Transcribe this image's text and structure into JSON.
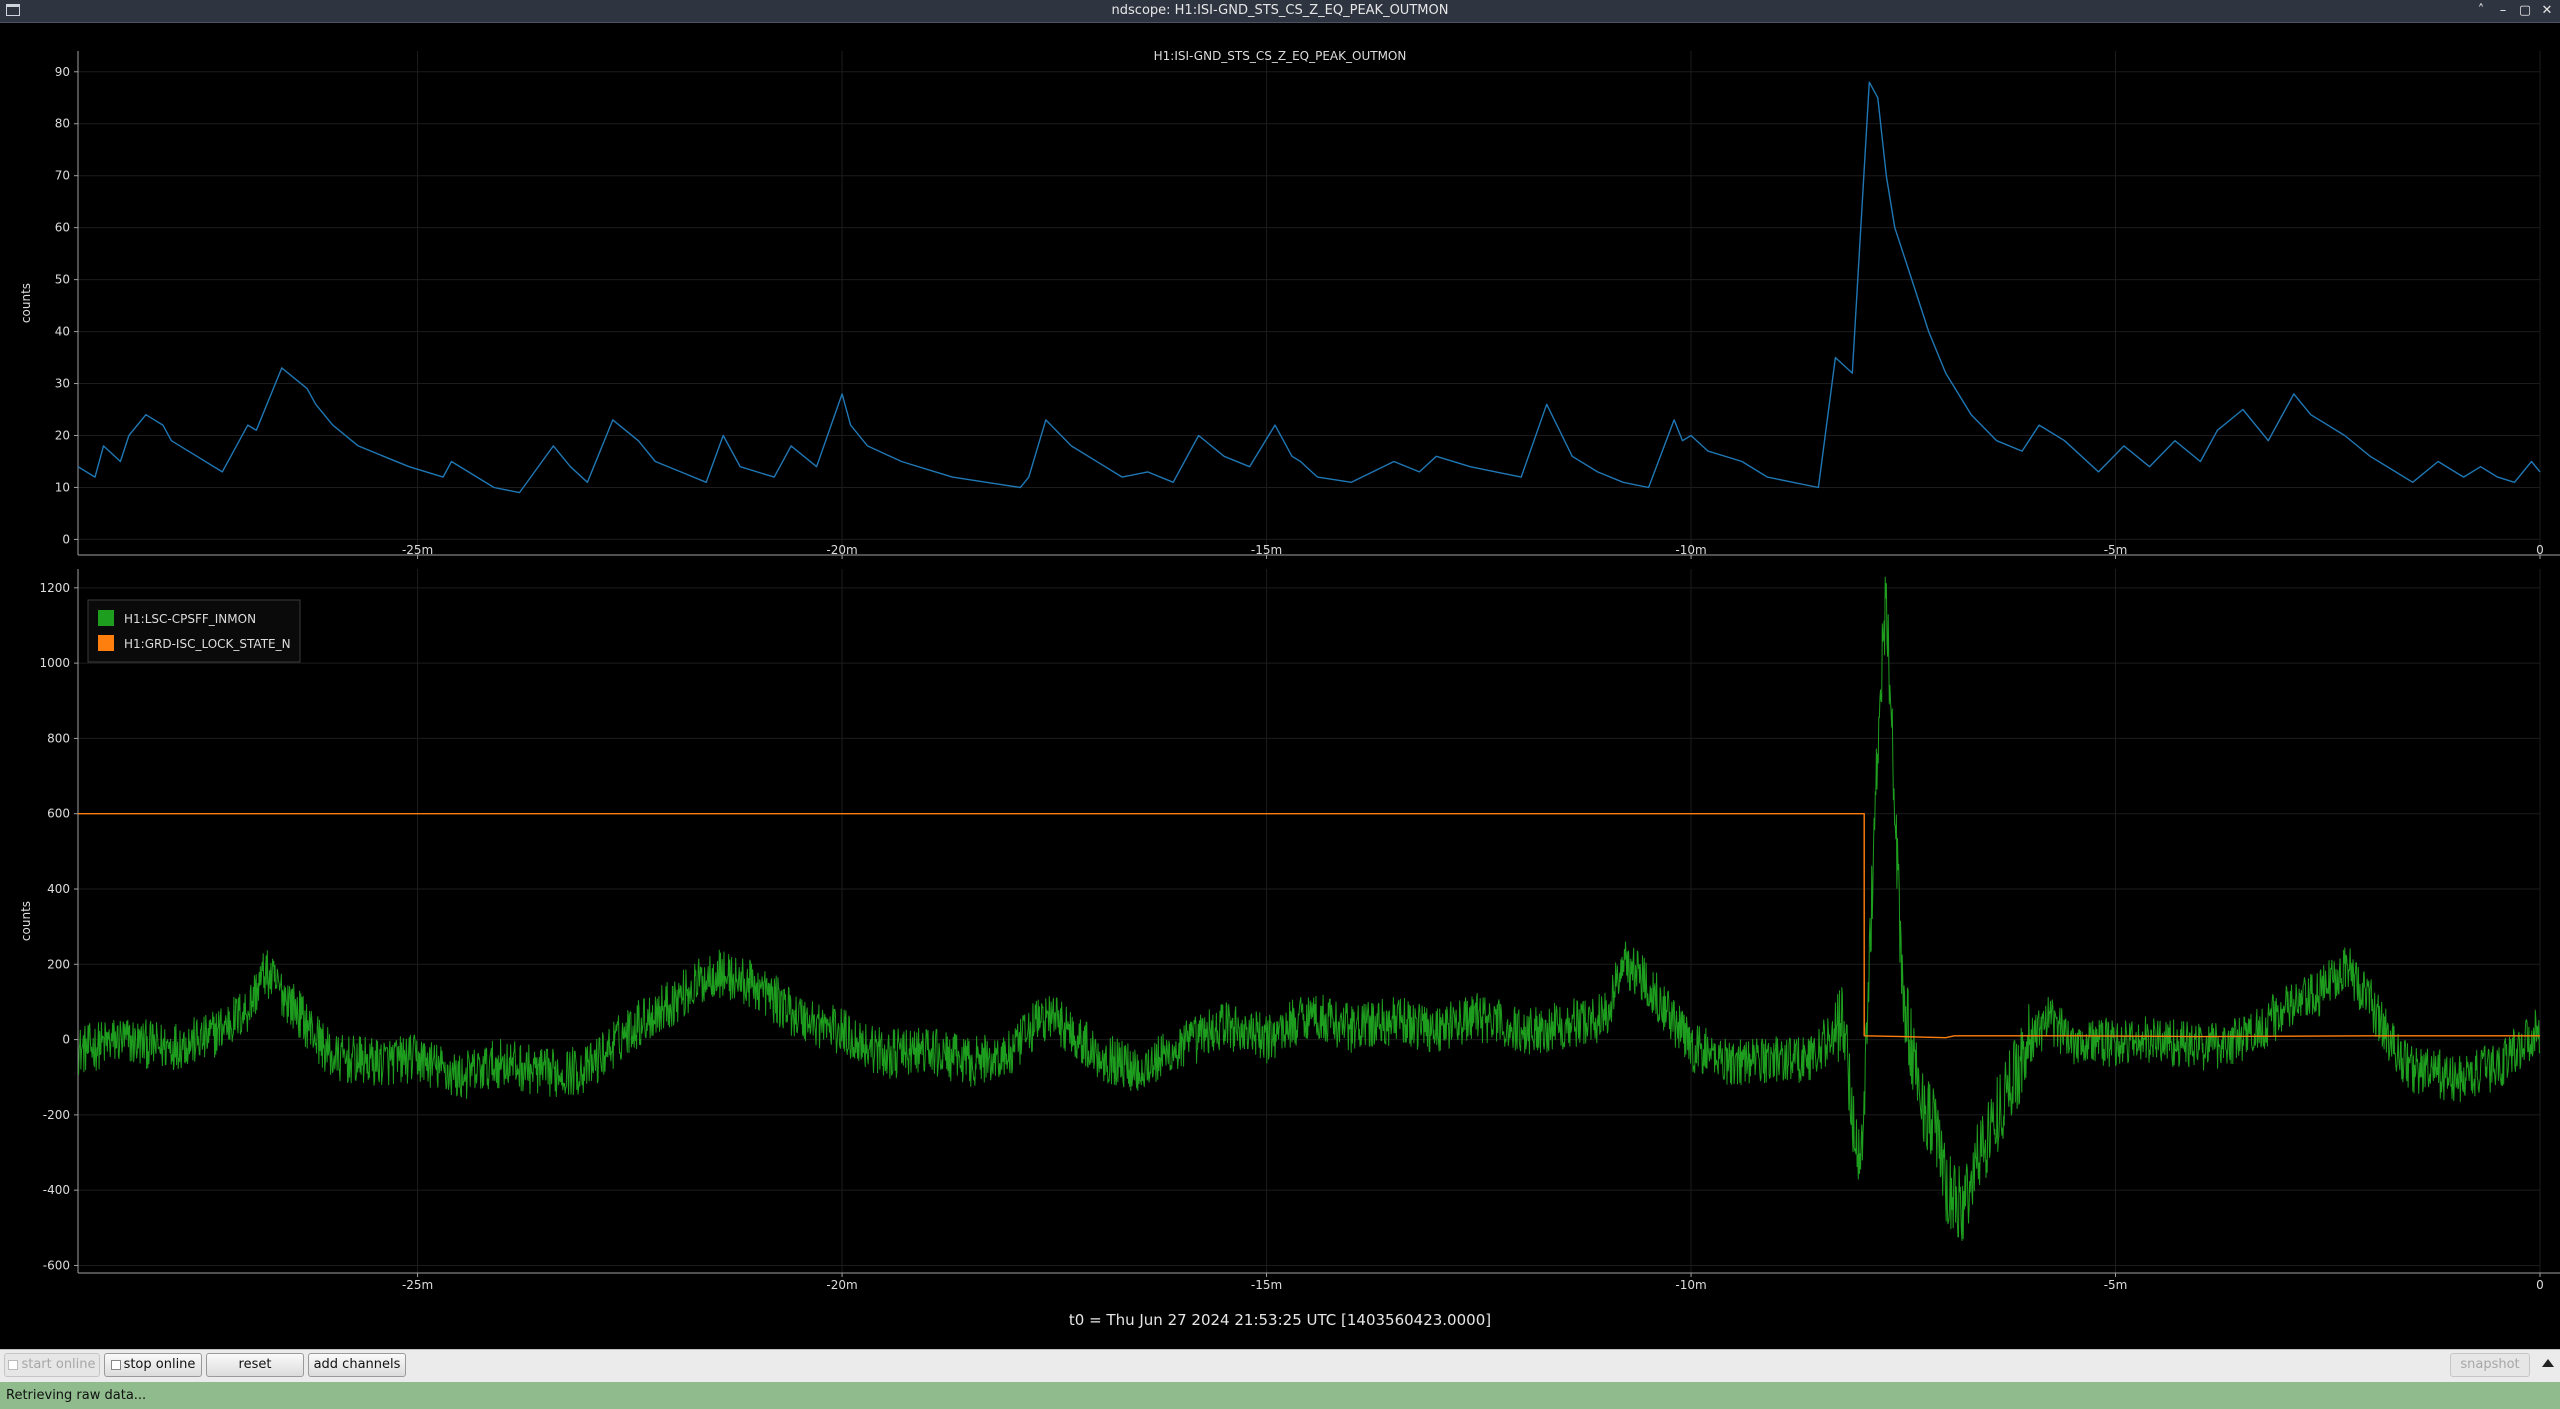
{
  "window": {
    "title": "ndscope: H1:ISI-GND_STS_CS_Z_EQ_PEAK_OUTMON",
    "controls": [
      "chevron-up-icon",
      "minimize-icon",
      "maximize-icon",
      "close-icon"
    ]
  },
  "colors": {
    "background": "#000000",
    "blue_trace": "#1f77b4",
    "green_trace": "#1e9e1e",
    "orange_trace": "#ff7f0e",
    "status_bar": "#8fbb8d"
  },
  "chart_data": [
    {
      "type": "line",
      "title": "H1:ISI-GND_STS_CS_Z_EQ_PEAK_OUTMON",
      "xlabel": "",
      "ylabel": "counts",
      "xlim": [
        -29,
        0
      ],
      "ylim": [
        -3,
        94
      ],
      "x_ticks": [
        -25,
        -20,
        -15,
        -10,
        -5,
        0
      ],
      "x_tick_labels": [
        "-25m",
        "-20m",
        "-15m",
        "-10m",
        "-5m",
        "0"
      ],
      "y_ticks": [
        0,
        10,
        20,
        30,
        40,
        50,
        60,
        70,
        80,
        90
      ],
      "grid": true,
      "series": [
        {
          "color": "#1f77b4",
          "x": [
            -29.0,
            -28.8,
            -28.7,
            -28.5,
            -28.4,
            -28.2,
            -28.0,
            -27.9,
            -27.6,
            -27.3,
            -27.0,
            -26.9,
            -26.6,
            -26.3,
            -26.2,
            -26.0,
            -25.7,
            -25.4,
            -25.1,
            -24.7,
            -24.6,
            -24.3,
            -24.1,
            -23.8,
            -23.4,
            -23.2,
            -23.0,
            -22.7,
            -22.4,
            -22.2,
            -21.9,
            -21.6,
            -21.4,
            -21.2,
            -20.8,
            -20.6,
            -20.3,
            -20.0,
            -19.9,
            -19.7,
            -19.3,
            -18.9,
            -18.7,
            -18.3,
            -17.9,
            -17.8,
            -17.6,
            -17.3,
            -16.9,
            -16.7,
            -16.4,
            -16.1,
            -15.8,
            -15.5,
            -15.2,
            -14.9,
            -14.7,
            -14.6,
            -14.4,
            -14.0,
            -13.5,
            -13.2,
            -13.0,
            -12.6,
            -12.3,
            -12.0,
            -11.7,
            -11.4,
            -11.1,
            -10.8,
            -10.5,
            -10.2,
            -10.1,
            -10.0,
            -9.8,
            -9.4,
            -9.1,
            -8.8,
            -8.5,
            -8.3,
            -8.1,
            -7.9,
            -7.8,
            -7.7,
            -7.6,
            -7.4,
            -7.2,
            -7.0,
            -6.7,
            -6.4,
            -6.1,
            -5.9,
            -5.6,
            -5.4,
            -5.2,
            -4.9,
            -4.6,
            -4.3,
            -4.0,
            -3.8,
            -3.5,
            -3.2,
            -2.9,
            -2.7,
            -2.3,
            -2.0,
            -1.7,
            -1.5,
            -1.2,
            -0.9,
            -0.7,
            -0.5,
            -0.3,
            -0.1,
            0.0
          ],
          "y": [
            14,
            12,
            18,
            15,
            20,
            24,
            22,
            19,
            16,
            13,
            22,
            21,
            33,
            29,
            26,
            22,
            18,
            16,
            14,
            12,
            15,
            12,
            10,
            9,
            18,
            14,
            11,
            23,
            19,
            15,
            13,
            11,
            20,
            14,
            12,
            18,
            14,
            28,
            22,
            18,
            15,
            13,
            12,
            11,
            10,
            12,
            23,
            18,
            14,
            12,
            13,
            11,
            20,
            16,
            14,
            22,
            16,
            15,
            12,
            11,
            15,
            13,
            16,
            14,
            13,
            12,
            26,
            16,
            13,
            11,
            10,
            23,
            19,
            20,
            17,
            15,
            12,
            11,
            10,
            35,
            32,
            88,
            85,
            70,
            60,
            50,
            40,
            32,
            24,
            19,
            17,
            22,
            19,
            16,
            13,
            18,
            14,
            19,
            15,
            21,
            25,
            19,
            28,
            24,
            20,
            16,
            13,
            11,
            15,
            12,
            14,
            12,
            11,
            15,
            13
          ]
        }
      ]
    },
    {
      "type": "line",
      "title": "",
      "xlabel": "t0 = Thu Jun 27 2024 21:53:25 UTC [1403560423.0000]",
      "ylabel": "counts",
      "xlim": [
        -29,
        0
      ],
      "ylim": [
        -620,
        1250
      ],
      "x_ticks": [
        -25,
        -20,
        -15,
        -10,
        -5,
        0
      ],
      "x_tick_labels": [
        "-25m",
        "-20m",
        "-15m",
        "-10m",
        "-5m",
        "0"
      ],
      "y_ticks": [
        -600,
        -400,
        -200,
        0,
        200,
        400,
        600,
        800,
        1000,
        1200
      ],
      "grid": true,
      "legend": "top-left",
      "series": [
        {
          "name": "H1:LSC-CPSFF_INMON",
          "color": "#1e9e1e",
          "noise": 65,
          "x": [
            -29.0,
            -28.5,
            -28.0,
            -27.5,
            -27.0,
            -26.8,
            -26.5,
            -26.0,
            -25.5,
            -25.0,
            -24.5,
            -24.0,
            -23.5,
            -23.0,
            -22.5,
            -22.0,
            -21.5,
            -21.0,
            -20.5,
            -20.0,
            -19.5,
            -19.0,
            -18.5,
            -18.0,
            -17.7,
            -17.5,
            -17.0,
            -16.5,
            -16.0,
            -15.5,
            -15.0,
            -14.5,
            -14.0,
            -13.5,
            -13.0,
            -12.5,
            -12.0,
            -11.5,
            -11.0,
            -10.8,
            -10.5,
            -10.0,
            -9.5,
            -9.0,
            -8.6,
            -8.3,
            -8.2,
            -8.1,
            -8.0,
            -7.9,
            -7.8,
            -7.7,
            -7.6,
            -7.5,
            -7.3,
            -7.1,
            -7.0,
            -6.8,
            -6.6,
            -6.4,
            -6.2,
            -6.0,
            -5.8,
            -5.5,
            -5.0,
            -4.5,
            -4.0,
            -3.5,
            -3.0,
            -2.6,
            -2.3,
            -2.0,
            -1.7,
            -1.5,
            -1.2,
            -1.0,
            -0.5,
            0.0
          ],
          "y": [
            -30,
            0,
            -20,
            0,
            80,
            180,
            100,
            -50,
            -60,
            -50,
            -100,
            -60,
            -90,
            -80,
            30,
            100,
            180,
            140,
            60,
            20,
            -40,
            -30,
            -60,
            -40,
            50,
            60,
            -40,
            -80,
            -20,
            40,
            0,
            70,
            30,
            50,
            30,
            60,
            20,
            40,
            60,
            210,
            150,
            -20,
            -60,
            -50,
            -50,
            20,
            50,
            -200,
            -350,
            200,
            800,
            1200,
            600,
            100,
            -150,
            -250,
            -400,
            -450,
            -300,
            -200,
            -100,
            0,
            50,
            0,
            -10,
            0,
            -20,
            0,
            80,
            120,
            200,
            100,
            -30,
            -80,
            -90,
            -110,
            -70,
            30
          ]
        },
        {
          "name": "H1:GRD-ISC_LOCK_STATE_N",
          "color": "#ff7f0e",
          "x": [
            -29.0,
            -7.96,
            -7.96,
            -7.5,
            -7.0,
            -6.9,
            -5.5,
            -4.0,
            -2.0,
            0.0
          ],
          "y": [
            600,
            600,
            10,
            8,
            5,
            10,
            10,
            8,
            10,
            10
          ]
        }
      ]
    }
  ],
  "buttons": {
    "start_online": "start online",
    "stop_online": "stop online",
    "reset": "reset",
    "add_channels": "add channels",
    "snapshot": "snapshot"
  },
  "status": {
    "message": "Retrieving raw data..."
  }
}
